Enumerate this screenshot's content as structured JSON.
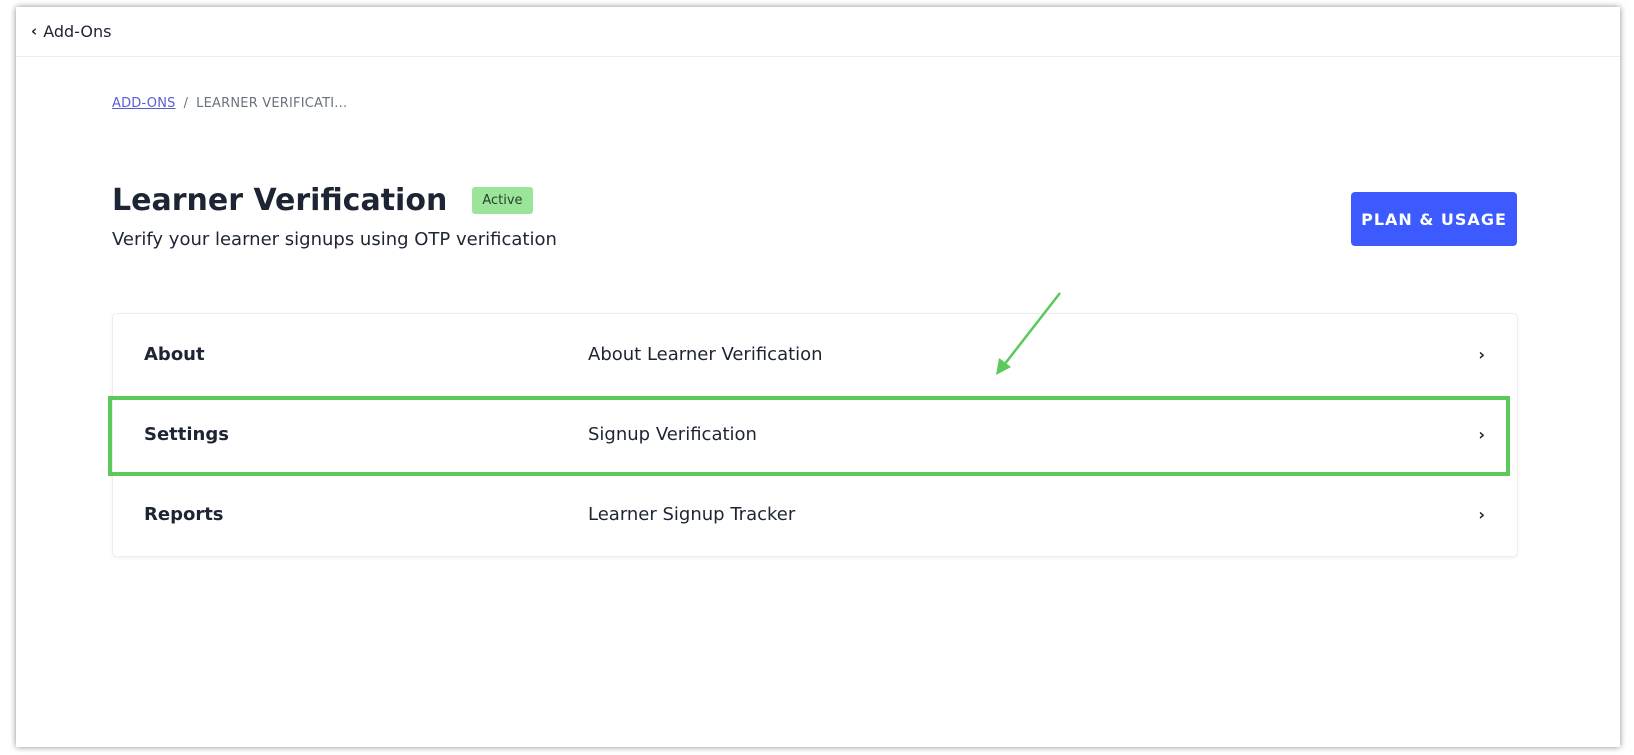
{
  "topbar": {
    "back_label": "Add-Ons"
  },
  "breadcrumb": {
    "items": [
      "ADD-ONS",
      "LEARNER VERIFICATI..."
    ],
    "separator": "/"
  },
  "header": {
    "title": "Learner Verification",
    "status": "Active",
    "subtitle": "Verify your learner signups using OTP verification",
    "plan_button_label": "PLAN & USAGE"
  },
  "rows": [
    {
      "label": "About",
      "value": "About Learner Verification"
    },
    {
      "label": "Settings",
      "value": "Signup Verification"
    },
    {
      "label": "Reports",
      "value": "Learner Signup Tracker"
    }
  ],
  "colors": {
    "accent": "#3d5afe",
    "badge": "#9be59a",
    "highlight": "#5bc95b",
    "link": "#5b5bd6"
  },
  "icons": [
    "chevron-left-icon",
    "chevron-right-icon",
    "annotation-arrow-icon"
  ]
}
